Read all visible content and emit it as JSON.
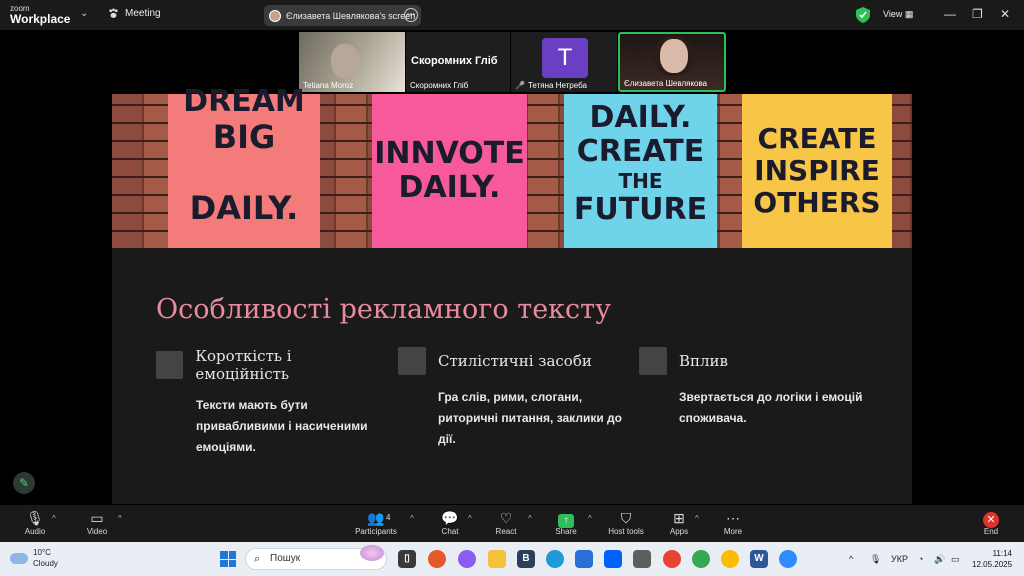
{
  "titlebar": {
    "logo_line1": "zoom",
    "logo_line2": "Workplace",
    "meeting_label": "Meeting",
    "screen_share_label": "Єлизавета Шевлякова's screen",
    "view_label": "View",
    "minimize": "—",
    "maximize": "❐",
    "close": "✕"
  },
  "participants": [
    {
      "name": "Tetiana Moroz"
    },
    {
      "name": "Скоромних Гліб",
      "display_name": "Скоромних Гліб"
    },
    {
      "name": "Тетяна Нетреба",
      "avatar_letter": "T"
    },
    {
      "name": "Єлизавета Шевлякова"
    }
  ],
  "slide": {
    "notes": [
      {
        "top": "DREAM",
        "line1": "BIG",
        "line2": "DAILY."
      },
      {
        "line1": "INNVOTE",
        "line2": "DAILY."
      },
      {
        "line1": "DAILY.",
        "line2": "CREATE",
        "line3": "THE",
        "line4": "FUTURE"
      },
      {
        "line1": "CREATE",
        "line2": "INSPIRE",
        "line3": "OTHERS"
      }
    ],
    "title": "Особливості рекламного тексту",
    "columns": [
      {
        "heading": "Короткість і емоційність",
        "body": "Тексти мають бути привабливими і насиченими емоціями."
      },
      {
        "heading": "Стилістичні засоби",
        "body": "Гра слів, рими, слогани, риторичні питання, заклики до дії."
      },
      {
        "heading": "Вплив",
        "body": "Звертається до логіки і емоцій споживача."
      }
    ]
  },
  "toolbar": {
    "audio": "Audio",
    "video": "Video",
    "participants": "Participants",
    "participants_count": "4",
    "chat": "Chat",
    "react": "React",
    "share": "Share",
    "host_tools": "Host tools",
    "apps": "Apps",
    "more": "More",
    "end": "End"
  },
  "taskbar": {
    "temp": "10°C",
    "condition": "Cloudy",
    "search_placeholder": "Пошук",
    "lang": "УКР",
    "time": "11:14",
    "date": "12.05.2025"
  },
  "colors": {
    "accent_green": "#2fbf58",
    "slide_title": "#e98aa0",
    "end_red": "#e0312f"
  }
}
